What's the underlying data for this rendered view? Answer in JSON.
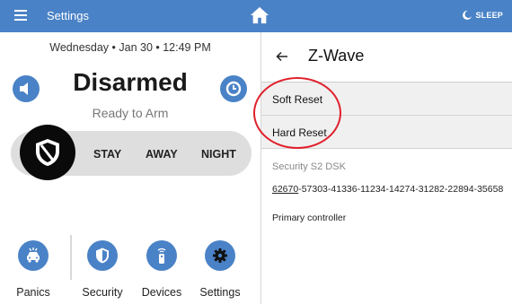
{
  "topbar": {
    "title": "Settings",
    "sleep_label": "SLEEP"
  },
  "left": {
    "datetime": "Wednesday  •  Jan 30  •  12:49 PM",
    "status": "Disarmed",
    "substatus": "Ready to Arm",
    "modes": [
      "STAY",
      "AWAY",
      "NIGHT"
    ],
    "nav": [
      "Panics",
      "Security",
      "Devices",
      "Settings"
    ]
  },
  "zwave": {
    "title": "Z-Wave",
    "items": [
      "Soft Reset",
      "Hard Reset"
    ],
    "s2_label": "Security S2 DSK",
    "dsk_prefix": "62670",
    "dsk_rest": "-57303-41336-11234-14274-31282-22894-35658",
    "primary": "Primary controller"
  },
  "colors": {
    "accent": "#4a82c7",
    "annotation": "#e0202c"
  }
}
